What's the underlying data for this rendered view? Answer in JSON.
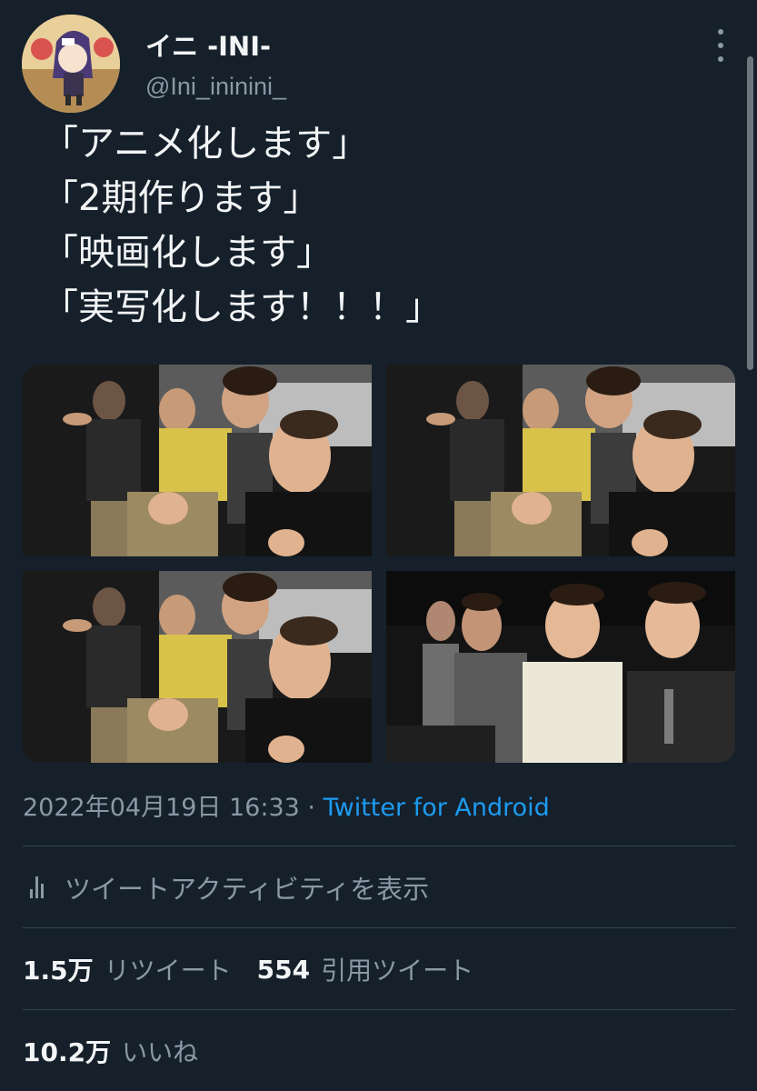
{
  "header": {
    "display_name": "イニ -INI-",
    "handle": "@Ini_ininini_",
    "avatar_icon": "avatar-icon",
    "more_icon": "more-vertical-icon"
  },
  "tweet": {
    "lines": [
      "「アニメ化します」",
      "「2期作ります」",
      "「映画化します」",
      "「実写化します！！！」"
    ]
  },
  "media": {
    "images": [
      {
        "alt": "photo-1"
      },
      {
        "alt": "photo-2"
      },
      {
        "alt": "photo-3"
      },
      {
        "alt": "photo-4"
      }
    ]
  },
  "meta": {
    "timestamp": "2022年04月19日 16:33",
    "separator": "·",
    "source": "Twitter for Android"
  },
  "activity": {
    "label": "ツイートアクティビティを表示",
    "icon": "analytics-icon"
  },
  "stats": {
    "retweets_count": "1.5万",
    "retweets_label": "リツイート",
    "quotes_count": "554",
    "quotes_label": "引用ツイート",
    "likes_count": "10.2万",
    "likes_label": "いいね"
  },
  "colors": {
    "background": "#15202b",
    "accent": "#1d9bf0",
    "secondary_text": "#8b98a5",
    "divider": "#38444d"
  }
}
